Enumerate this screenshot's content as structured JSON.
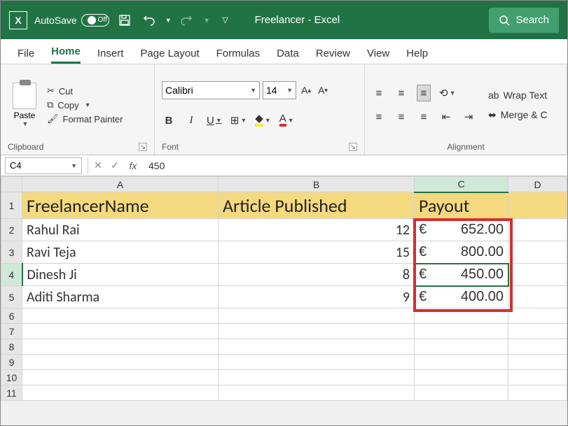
{
  "titlebar": {
    "autosave_label": "AutoSave",
    "autosave_state": "Off",
    "title": "Freelancer  -  Excel",
    "search_label": "Search"
  },
  "tabs": {
    "file": "File",
    "home": "Home",
    "insert": "Insert",
    "page_layout": "Page Layout",
    "formulas": "Formulas",
    "data": "Data",
    "review": "Review",
    "view": "View",
    "help": "Help"
  },
  "ribbon": {
    "clipboard": {
      "paste": "Paste",
      "cut": "Cut",
      "copy": "Copy",
      "format_painter": "Format Painter",
      "group_label": "Clipboard"
    },
    "font": {
      "name": "Calibri",
      "size": "14",
      "group_label": "Font"
    },
    "alignment": {
      "wrap": "Wrap Text",
      "merge": "Merge & C",
      "group_label": "Alignment"
    }
  },
  "namebox": "C4",
  "formula_value": "450",
  "columns": [
    "A",
    "B",
    "C",
    "D"
  ],
  "headers": {
    "A": "FreelancerName",
    "B": "Article Published",
    "C": "Payout"
  },
  "rows": [
    {
      "n": "1"
    },
    {
      "n": "2",
      "A": "Rahul Rai",
      "B": "12",
      "C_sym": "€",
      "C_val": "652.00"
    },
    {
      "n": "3",
      "A": "Ravi Teja",
      "B": "15",
      "C_sym": "€",
      "C_val": "800.00"
    },
    {
      "n": "4",
      "A": "Dinesh Ji",
      "B": "8",
      "C_sym": "€",
      "C_val": "450.00"
    },
    {
      "n": "5",
      "A": "Aditi Sharma",
      "B": "9",
      "C_sym": "€",
      "C_val": "400.00"
    },
    {
      "n": "6"
    },
    {
      "n": "7"
    },
    {
      "n": "8"
    },
    {
      "n": "9"
    },
    {
      "n": "10"
    },
    {
      "n": "11"
    }
  ],
  "active_cell": {
    "row": "4",
    "col": "C"
  }
}
